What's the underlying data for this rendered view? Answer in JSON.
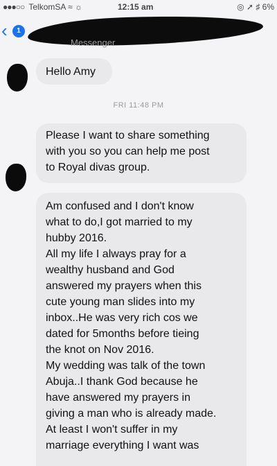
{
  "status_bar": {
    "signal": "●●●○○",
    "carrier": "TelkomSA",
    "time": "12:15 am",
    "battery": "6%"
  },
  "nav": {
    "back_badge": "1",
    "subtitle": "Messenger"
  },
  "messages": {
    "hello": "Hello Amy",
    "timestamp": "FRI 11:48 PM",
    "share_lines": [
      "Please I want to share something",
      "with you so you can help me post",
      "to Royal divas group."
    ],
    "long_lines": [
      "Am confused and I don't know",
      "what to do,I got married to my",
      "hubby 2016.",
      "All my life I always pray for a",
      "wealthy husband and God",
      "answered my prayers when this",
      "cute young man slides into my",
      "inbox..He was very rich cos we",
      "dated for 5months before tieing",
      "the knot on Nov 2016.",
      "My wedding was talk of the town",
      "Abuja..I thank God because he",
      "have answered my prayers in",
      "giving a man who is already made.",
      "At least I won't suffer in my",
      "marriage everything I want was"
    ]
  }
}
